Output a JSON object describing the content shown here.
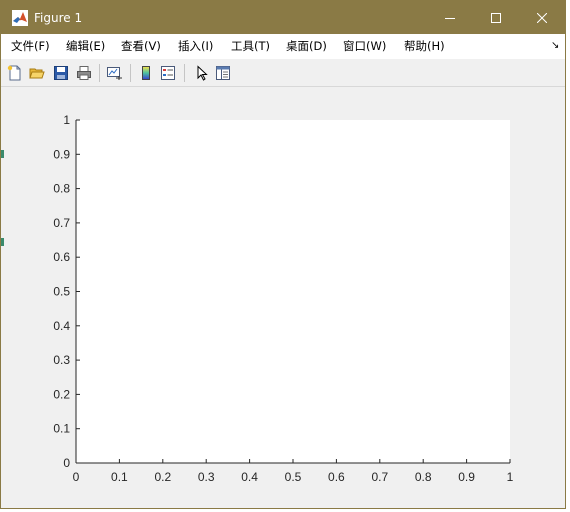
{
  "window": {
    "title": "Figure 1",
    "controls": {
      "minimize": "minimize",
      "maximize": "maximize",
      "close": "close"
    }
  },
  "menubar": {
    "items": [
      {
        "label": "文件(F)"
      },
      {
        "label": "编辑(E)"
      },
      {
        "label": "查看(V)"
      },
      {
        "label": "插入(I)"
      },
      {
        "label": "工具(T)"
      },
      {
        "label": "桌面(D)"
      },
      {
        "label": "窗口(W)"
      },
      {
        "label": "帮助(H)"
      }
    ],
    "expand_glyph": "↘"
  },
  "toolbar": {
    "buttons": [
      {
        "icon": "new-figure-icon"
      },
      {
        "icon": "open-file-icon"
      },
      {
        "icon": "save-icon"
      },
      {
        "icon": "print-icon"
      },
      {
        "icon": "link-plot-icon"
      },
      {
        "icon": "colorbar-icon"
      },
      {
        "icon": "legend-icon"
      },
      {
        "icon": "edit-plot-icon"
      },
      {
        "icon": "property-inspector-icon"
      }
    ]
  },
  "colors": {
    "titlebar": "#8a7a45",
    "axes_background": "#ffffff",
    "figure_background": "#f0f0f0",
    "axis_color": "#262626"
  },
  "chart_data": {
    "type": "line",
    "series": [],
    "xlim": [
      0,
      1
    ],
    "ylim": [
      0,
      1
    ],
    "x_ticks": [
      "0",
      "0.1",
      "0.2",
      "0.3",
      "0.4",
      "0.5",
      "0.6",
      "0.7",
      "0.8",
      "0.9",
      "1"
    ],
    "y_ticks": [
      "0",
      "0.1",
      "0.2",
      "0.3",
      "0.4",
      "0.5",
      "0.6",
      "0.7",
      "0.8",
      "0.9",
      "1"
    ],
    "grid": false,
    "legend": "none",
    "title": "",
    "xlabel": "",
    "ylabel": ""
  }
}
